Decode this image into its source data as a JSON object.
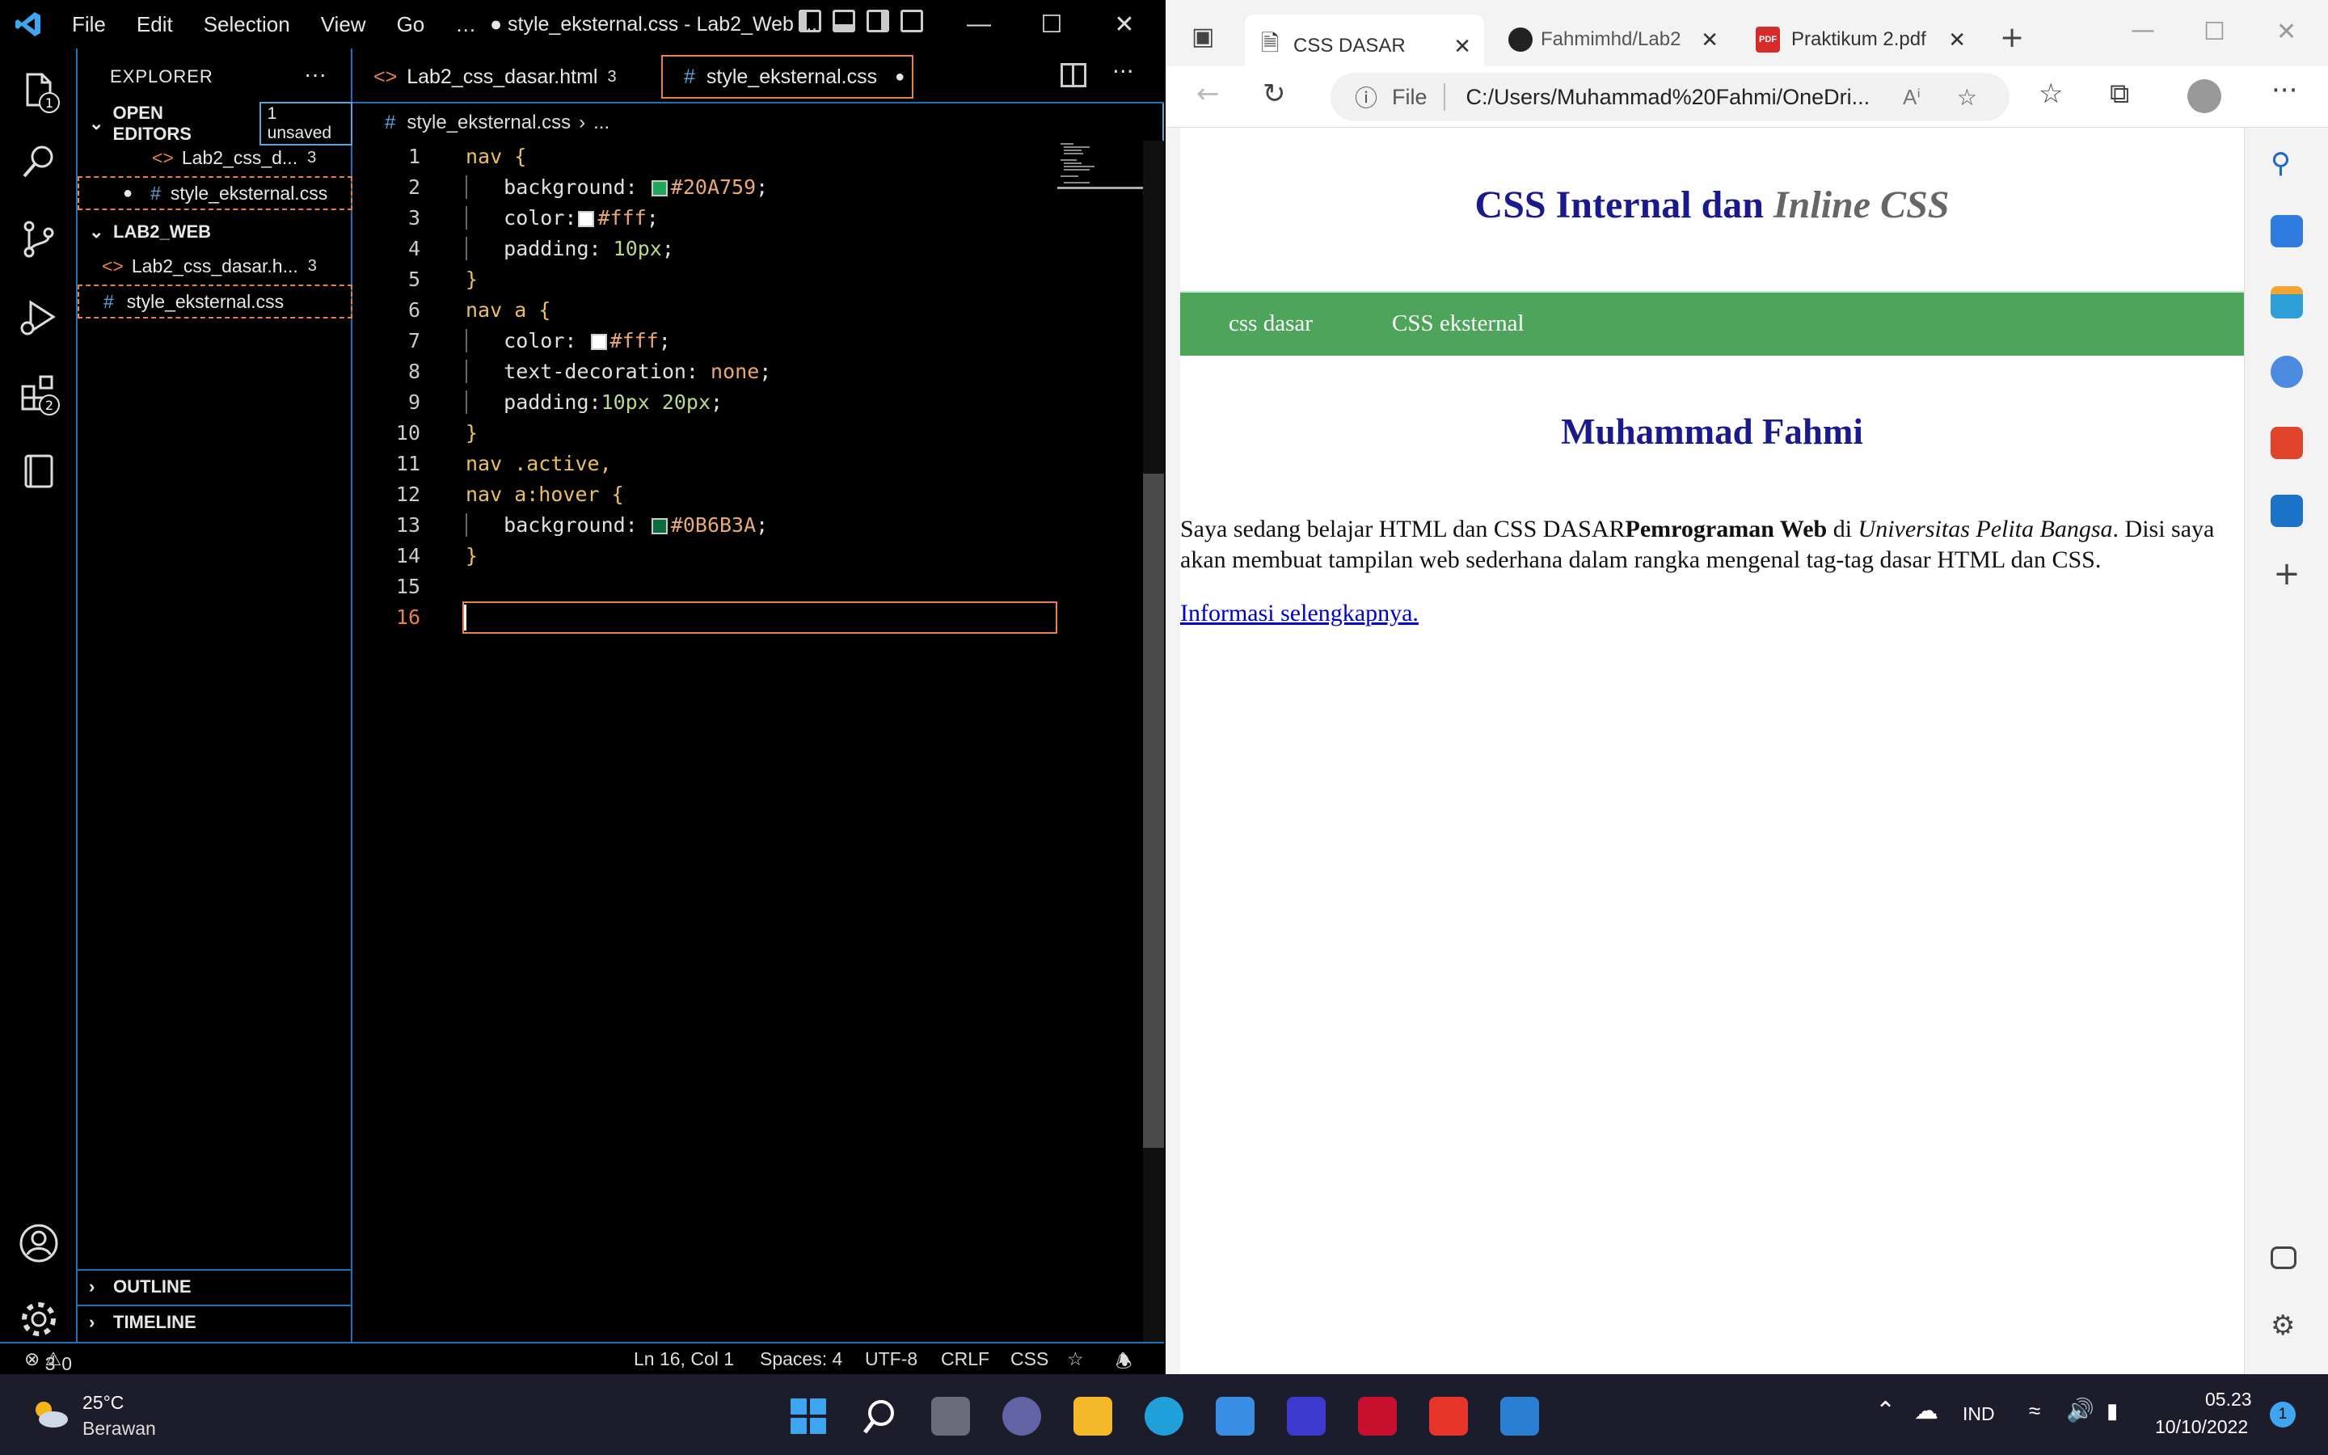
{
  "vscode": {
    "menu": [
      "File",
      "Edit",
      "Selection",
      "View",
      "Go",
      "…"
    ],
    "window_title": "● style_eksternal.css - Lab2_Web -...",
    "explorer": {
      "title": "EXPLORER",
      "open_editors_label": "OPEN EDITORS",
      "unsaved_badge": "1 unsaved",
      "open_editors": [
        {
          "name": "Lab2_css_d...",
          "count": "3"
        },
        {
          "name": "style_eksternal.css",
          "count": ""
        }
      ],
      "folder_label": "LAB2_WEB",
      "files": [
        {
          "name": "Lab2_css_dasar.h...",
          "count": "3"
        },
        {
          "name": "style_eksternal.css",
          "count": ""
        }
      ],
      "outline_label": "OUTLINE",
      "timeline_label": "TIMELINE"
    },
    "activity_badges": {
      "explorer": "1",
      "extensions": "2"
    },
    "tabs": [
      {
        "name": "Lab2_css_dasar.html",
        "count": "3"
      },
      {
        "name": "style_eksternal.css",
        "count": ""
      }
    ],
    "breadcrumb": {
      "file": "style_eksternal.css",
      "rest": "..."
    },
    "code": {
      "l1": "nav",
      "l2p": "background:",
      "l2c": "#20A759",
      "l3p": "color:",
      "l3c": "#fff",
      "l4p": "padding:",
      "l4v": "10px",
      "l6": "nav a",
      "l7p": "color:",
      "l7c": "#fff",
      "l8p": "text-decoration:",
      "l8v": "none",
      "l9p": "padding:",
      "l9v": "10px 20px",
      "l11": "nav .active,",
      "l12": "nav a:hover",
      "l13p": "background:",
      "l13c": "#0B6B3A"
    },
    "line_numbers": [
      "1",
      "2",
      "3",
      "4",
      "5",
      "6",
      "7",
      "8",
      "9",
      "10",
      "11",
      "12",
      "13",
      "14",
      "15",
      "16"
    ],
    "status": {
      "errors": "3",
      "warnings": "0",
      "position": "Ln 16, Col 1",
      "spaces": "Spaces: 4",
      "encoding": "UTF-8",
      "eol": "CRLF",
      "language": "CSS"
    }
  },
  "edge": {
    "tabs": [
      {
        "title": "CSS DASAR"
      },
      {
        "title": "Fahmimhd/Lab2"
      },
      {
        "title": "Praktikum 2.pdf"
      }
    ],
    "address_label": "File",
    "address": "C:/Users/Muhammad%20Fahmi/OneDri...",
    "page": {
      "title_normal": "CSS Internal dan ",
      "title_italic": "Inline CSS",
      "nav_links": [
        "css dasar",
        "CSS eksternal"
      ],
      "heading": "Muhammad Fahmi",
      "para_1": "Saya sedang belajar HTML dan CSS DASAR",
      "para_bold": "Pemrograman Web",
      "para_2": " di ",
      "para_italic": "Universitas Pelita Bangsa",
      "para_3": ". Disi saya akan membuat tampilan web sederhana dalam rangka mengenal tag-tag dasar HTML dan CSS.",
      "link": "Informasi selengkapnya."
    }
  },
  "taskbar": {
    "weather_temp": "25°C",
    "weather_desc": "Berawan",
    "lang": "IND",
    "time": "05.23",
    "date": "10/10/2022",
    "notif_count": "1"
  },
  "colors": {
    "nav_green": "#4ca55a",
    "accent_orange": "#e8804a",
    "vs_blue": "#1d6fb8",
    "heading_blue": "#1a1a8c",
    "swatch_1": "#20A759",
    "swatch_2": "#0B6B3A"
  }
}
